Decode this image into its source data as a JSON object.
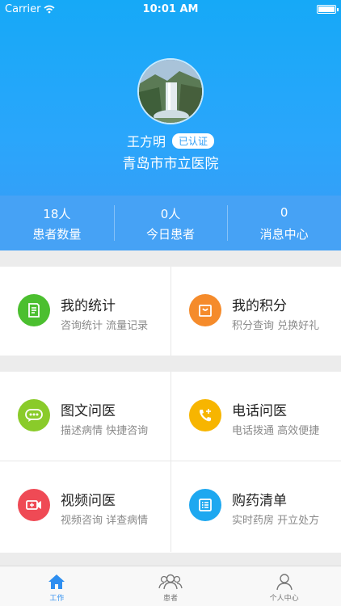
{
  "status_bar": {
    "carrier": "Carrier",
    "time": "10:01 AM"
  },
  "profile": {
    "name": "王方明",
    "badge": "已认证",
    "hospital": "青岛市市立医院"
  },
  "stats": [
    {
      "value": "18人",
      "label": "患者数量"
    },
    {
      "value": "0人",
      "label": "今日患者"
    },
    {
      "value": "0",
      "label": "消息中心"
    }
  ],
  "section1": [
    {
      "title": "我的统计",
      "subtitle": "咨询统计 流量记录",
      "icon": "document-icon",
      "color": "#4bbf2f"
    },
    {
      "title": "我的积分",
      "subtitle": "积分查询 兑换好礼",
      "icon": "bag-icon",
      "color": "#f58b2b"
    }
  ],
  "section2": [
    {
      "title": "图文问医",
      "subtitle": "描述病情 快捷咨询",
      "icon": "chat-icon",
      "color": "#8acb2a"
    },
    {
      "title": "电话问医",
      "subtitle": "电话拨通 高效便捷",
      "icon": "phone-icon",
      "color": "#f7b500"
    },
    {
      "title": "视频问医",
      "subtitle": "视频咨询 详查病情",
      "icon": "video-icon",
      "color": "#ef4a55"
    },
    {
      "title": "购药清单",
      "subtitle": "实时药房 开立处方",
      "icon": "list-icon",
      "color": "#1ea8f0"
    }
  ],
  "tabs": [
    {
      "label": "工作",
      "icon": "home-icon",
      "active": true
    },
    {
      "label": "患者",
      "icon": "patients-icon",
      "active": false
    },
    {
      "label": "个人中心",
      "icon": "person-icon",
      "active": false
    }
  ]
}
